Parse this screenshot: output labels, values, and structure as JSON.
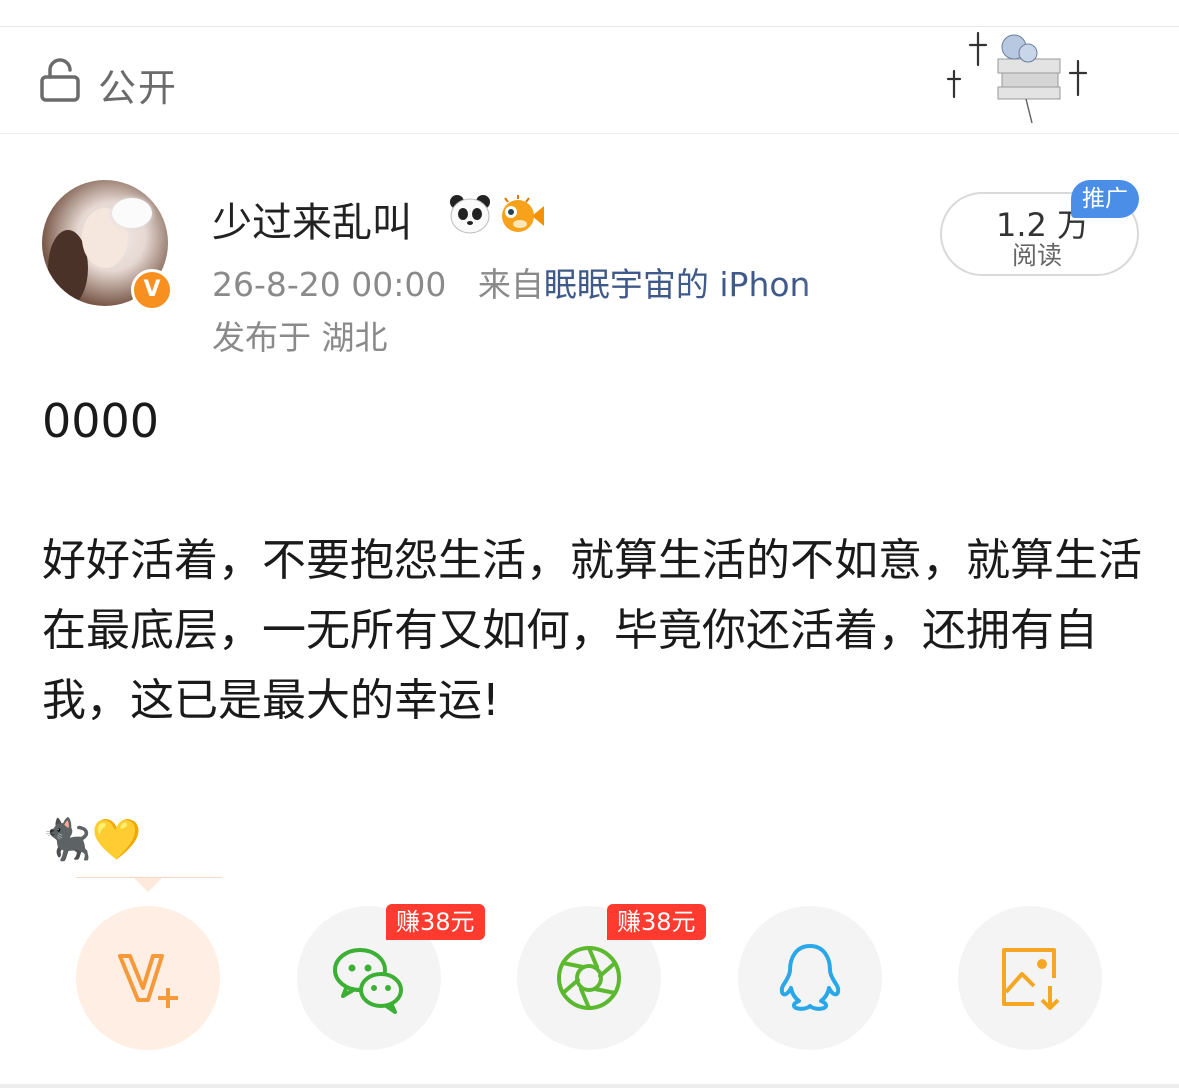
{
  "header": {
    "visibility_label": "公开"
  },
  "post": {
    "username": "少过来乱叫",
    "timestamp": "26-8-20 00:00",
    "source_prefix": "来自",
    "source": "眠眠宇宙的 iPhon",
    "location": "发布于 湖北",
    "read_count": "1.2 万",
    "read_label": "阅读",
    "promo_tag": "推广",
    "vip_badge": "V",
    "title": "0000",
    "body": "好好活着，不要抱怨生活，就算生活的不如意，就算生活在最底层，一无所有又如何，毕竟你还活着，还拥有自我，这已是最大的幸运!",
    "emoji": "🐈‍⬛💛"
  },
  "share": {
    "wechat_reward": "赚38元",
    "moments_reward": "赚38元"
  },
  "colors": {
    "accent_orange": "#f7901e",
    "reward_red": "#ff3b30",
    "wechat_green": "#3cb035",
    "qq_blue": "#2aa7e8",
    "save_orange": "#f5a623",
    "promo_blue": "#4a8ee8"
  },
  "icons": [
    "lock-icon",
    "panda-icon",
    "pufferfish-icon",
    "v-plus-icon",
    "wechat-icon",
    "moments-icon",
    "qq-icon",
    "save-image-icon"
  ]
}
